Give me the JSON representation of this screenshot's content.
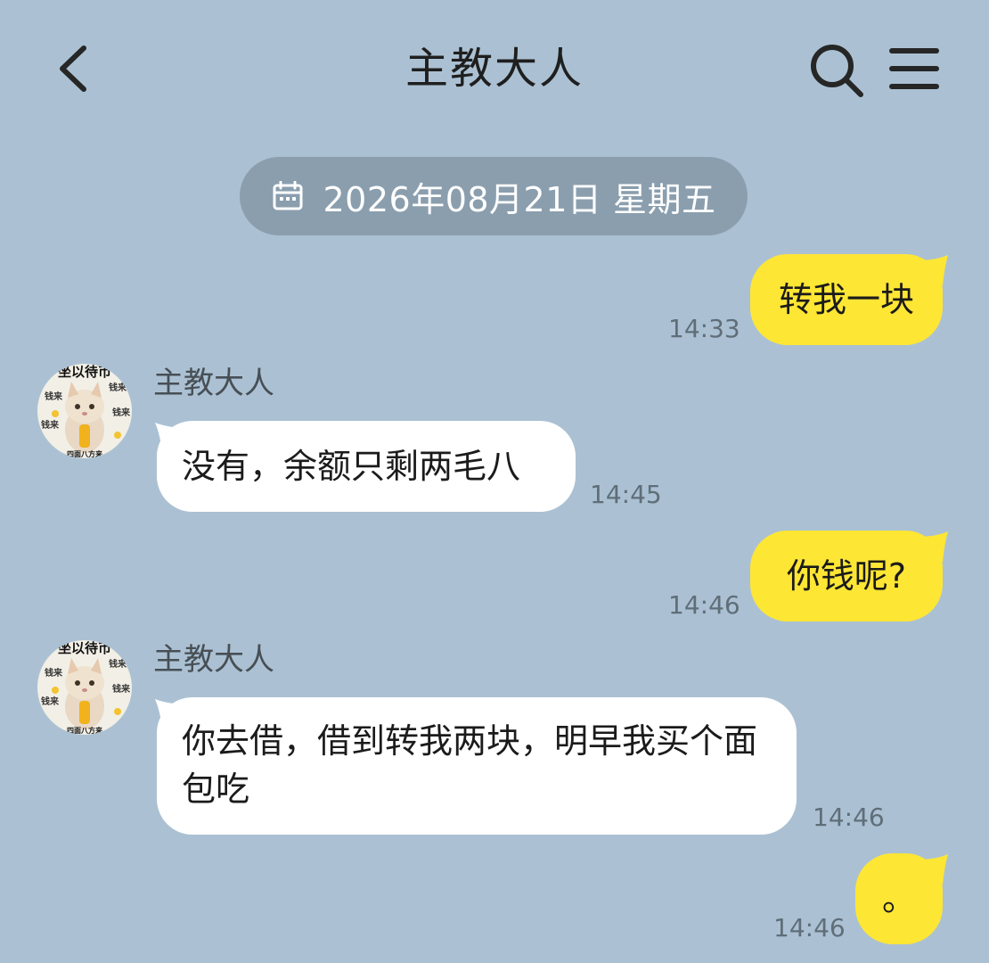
{
  "header": {
    "title": "主教大人",
    "back_icon": "chevron-left-icon",
    "search_icon": "search-icon",
    "menu_icon": "menu-icon"
  },
  "date_divider": {
    "icon": "calendar-icon",
    "text": "2026年08月21日 星期五"
  },
  "avatar": {
    "banner_text": "坐以待币",
    "side_text": "钱来",
    "bottom_text": "四面八方来"
  },
  "messages": [
    {
      "side": "out",
      "text": "转我一块",
      "time": "14:33"
    },
    {
      "side": "in",
      "sender": "主教大人",
      "text": "没有，余额只剩两毛八",
      "time": "14:45"
    },
    {
      "side": "out",
      "text": "你钱呢?",
      "time": "14:46"
    },
    {
      "side": "in",
      "sender": "主教大人",
      "text": "你去借，借到转我两块，明早我买个面包吃",
      "time": "14:46"
    },
    {
      "side": "out",
      "text": "。",
      "time": "14:46"
    }
  ],
  "colors": {
    "background": "#abc1d3",
    "outgoing_bubble": "#fee634",
    "incoming_bubble": "#ffffff",
    "date_pill": "#8a9eae"
  }
}
